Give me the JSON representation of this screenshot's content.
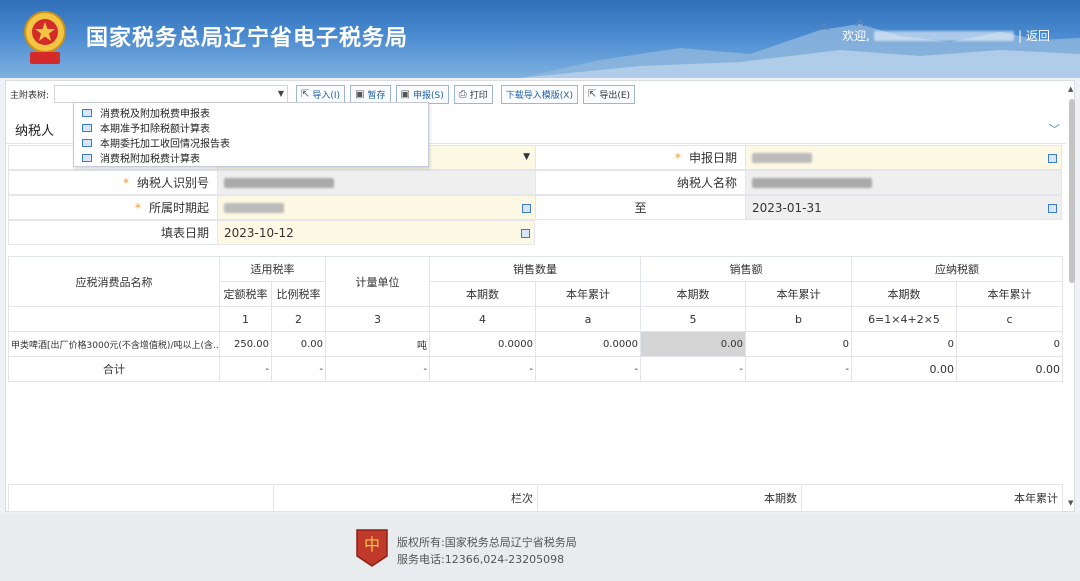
{
  "header": {
    "title": "国家税务总局辽宁省电子税务局",
    "welcome": "欢迎,",
    "separator": "|",
    "back": "返回",
    "emblem_caption": "中国税务"
  },
  "toolbar": {
    "label": "主附表树:",
    "buttons": [
      {
        "icon": "import-icon",
        "label": "导入(I)"
      },
      {
        "icon": "save-icon",
        "label": "暂存"
      },
      {
        "icon": "declare-icon",
        "label": "申报(S)"
      },
      {
        "icon": "print-icon",
        "label": "打印"
      },
      {
        "icon": "",
        "label": "下载导入模版(X)"
      },
      {
        "icon": "export-icon",
        "label": "导出(E)"
      }
    ]
  },
  "tree": {
    "items": [
      "消费税及附加税费申报表",
      "本期准予扣除税额计算表",
      "本期委托加工收回情况报告表",
      "消费税附加税费计算表"
    ]
  },
  "tab": {
    "label": "纳税人"
  },
  "form": {
    "declare_date_label": "申报日期",
    "taxpayer_id_label": "纳税人识别号",
    "taxpayer_name_label": "纳税人名称",
    "period_start_label": "所属时期起",
    "to_label": "至",
    "period_end": "2023-01-31",
    "fill_date_label": "填表日期",
    "fill_date": "2023-10-12",
    "required_mark": "*"
  },
  "table": {
    "h_name": "应税消费品名称",
    "h_rate": "适用税率",
    "h_rate_fixed": "定额税率",
    "h_rate_ratio": "比例税率",
    "h_unit": "计量单位",
    "h_sales_qty": "销售数量",
    "h_sales_amt": "销售额",
    "h_tax": "应纳税额",
    "h_cur": "本期数",
    "h_ytd": "本年累计",
    "col_nums": [
      "1",
      "2",
      "3",
      "4",
      "a",
      "5",
      "b",
      "6=1×4+2×5",
      "c"
    ],
    "row1": {
      "name": "甲类啤酒[出厂价格3000元(不含增值税)/吨以上(含...",
      "fixed_rate": "250.00",
      "ratio_rate": "0.00",
      "unit": "吨",
      "qty_cur": "0.0000",
      "qty_ytd": "0.0000",
      "amt_cur": "0.00",
      "amt_ytd": "0",
      "tax_cur": "0",
      "tax_ytd": "0"
    },
    "total": {
      "label": "合计",
      "dash": "-",
      "tax_cur": "0.00",
      "tax_ytd": "0.00"
    }
  },
  "bottom": {
    "col_row": "栏次",
    "col_cur": "本期数",
    "col_ytd": "本年累计"
  },
  "footer": {
    "copyright": "版权所有:国家税务总局辽宁省税务局",
    "phone": "服务电话:12366,024-23205098"
  }
}
